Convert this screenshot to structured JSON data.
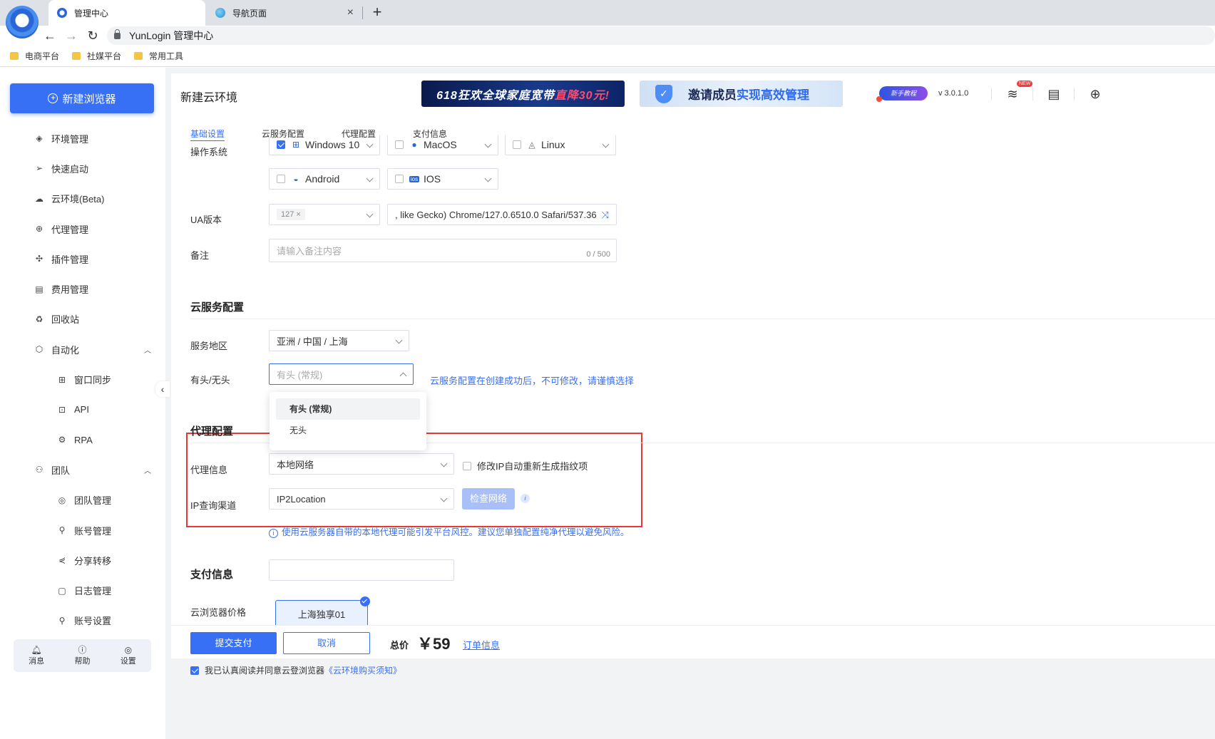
{
  "browser": {
    "tabs": [
      {
        "label": "管理中心",
        "active": true
      },
      {
        "label": "导航页面",
        "active": false
      }
    ],
    "address": "YunLogin 管理中心",
    "bookmarks": [
      "电商平台",
      "社媒平台",
      "常用工具"
    ]
  },
  "sidebar": {
    "new_button": "新建浏览器",
    "items": [
      {
        "label": "环境管理",
        "icon": "env-icon"
      },
      {
        "label": "快速启动",
        "icon": "send-icon"
      },
      {
        "label": "云环境(Beta)",
        "icon": "cloud-icon"
      },
      {
        "label": "代理管理",
        "icon": "globe-icon"
      },
      {
        "label": "插件管理",
        "icon": "puzzle-icon"
      },
      {
        "label": "费用管理",
        "icon": "billing-icon"
      },
      {
        "label": "回收站",
        "icon": "recycle-icon"
      },
      {
        "label": "自动化",
        "icon": "automation-icon",
        "expanded": true
      },
      {
        "label": "窗口同步",
        "icon": "window-sync-icon",
        "sub": true
      },
      {
        "label": "API",
        "icon": "api-icon",
        "sub": true
      },
      {
        "label": "RPA",
        "icon": "robot-icon",
        "sub": true
      },
      {
        "label": "团队",
        "icon": "team-icon",
        "expanded": true
      },
      {
        "label": "团队管理",
        "icon": "team-manage-icon",
        "sub": true
      },
      {
        "label": "账号管理",
        "icon": "user-icon",
        "sub": true
      },
      {
        "label": "分享转移",
        "icon": "share-icon",
        "sub": true
      },
      {
        "label": "日志管理",
        "icon": "log-icon",
        "sub": true
      },
      {
        "label": "账号设置",
        "icon": "user-settings-icon",
        "sub": true
      }
    ],
    "bottom": [
      {
        "label": "消息",
        "icon": "bell-icon"
      },
      {
        "label": "帮助",
        "icon": "help-icon"
      },
      {
        "label": "设置",
        "icon": "settings-icon"
      }
    ]
  },
  "header": {
    "title": "新建云环境",
    "banner1": {
      "text": "618狂欢全球家庭宽带",
      "highlight": "直降30元!"
    },
    "banner2": {
      "text": "邀请成员",
      "highlight": "实现高效管理"
    },
    "tutorial": "新手教程",
    "version": "v 3.0.1.0",
    "new_badge": "NEW"
  },
  "form": {
    "tabs": [
      "基础设置",
      "云服务配置",
      "代理配置",
      "支付信息"
    ],
    "os_label": "操作系统",
    "os_options": [
      {
        "name": "Windows 10",
        "checked": true
      },
      {
        "name": "MacOS",
        "checked": false
      },
      {
        "name": "Linux",
        "checked": false
      },
      {
        "name": "Android",
        "checked": false
      },
      {
        "name": "IOS",
        "checked": false
      }
    ],
    "ua_label": "UA版本",
    "ua_version": "127",
    "ua_string": ", like Gecko) Chrome/127.0.6510.0 Safari/537.36",
    "remark_label": "备注",
    "remark_placeholder": "请输入备注内容",
    "remark_counter": "0 / 500",
    "cloud_section": "云服务配置",
    "region_label": "服务地区",
    "region_value": "亚洲 / 中国 / 上海",
    "headless_label": "有头/无头",
    "headless_placeholder": "有头 (常规)",
    "headless_hint": "云服务配置在创建成功后，不可修改，请谨慎选择",
    "headless_options": [
      "有头 (常规)",
      "无头"
    ],
    "proxy_section": "代理配置",
    "proxy_label": "代理信息",
    "proxy_value": "本地网络",
    "proxy_regen": "修改IP自动重新生成指纹项",
    "ip_label": "IP查询渠道",
    "ip_value": "IP2Location",
    "check_button": "检查网络",
    "info_i": "i",
    "proxy_warning": "使用云服务器自带的本地代理可能引发平台风控。建议您单独配置纯净代理以避免风险。",
    "payment_section": "支付信息",
    "price_label": "云浏览器价格",
    "price_option": "上海独享01"
  },
  "footer": {
    "submit": "提交支付",
    "cancel": "取消",
    "total_label": "总价",
    "total_price": "￥59",
    "order_link": "订单信息",
    "agree_text": "我已认真阅读并同意云登浏览器",
    "agree_link": "《云环境购买须知》"
  }
}
